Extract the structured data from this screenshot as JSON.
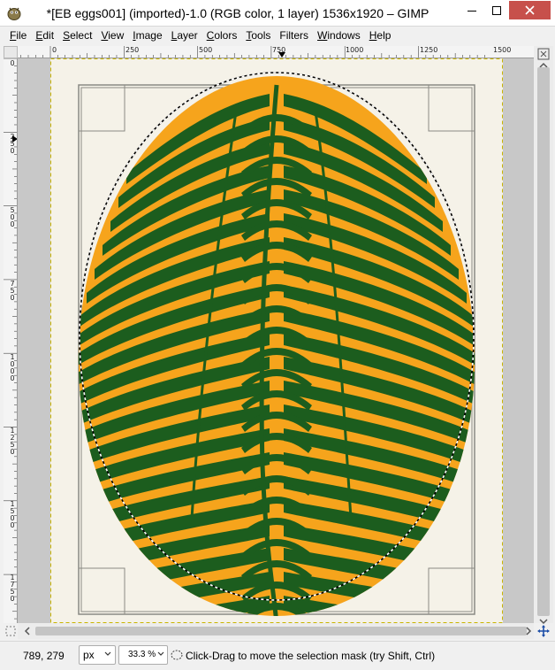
{
  "window": {
    "title": "*[EB eggs001] (imported)-1.0 (RGB color, 1 layer) 1536x1920 – GIMP"
  },
  "menu": [
    {
      "label": "File",
      "acc": "F",
      "rest": "ile"
    },
    {
      "label": "Edit",
      "acc": "E",
      "rest": "dit"
    },
    {
      "label": "Select",
      "acc": "S",
      "rest": "elect"
    },
    {
      "label": "View",
      "acc": "V",
      "rest": "iew"
    },
    {
      "label": "Image",
      "acc": "I",
      "rest": "mage"
    },
    {
      "label": "Layer",
      "acc": "L",
      "rest": "ayer"
    },
    {
      "label": "Colors",
      "acc": "C",
      "rest": "olors"
    },
    {
      "label": "Tools",
      "acc": "T",
      "rest": "ools"
    },
    {
      "label": "Filters",
      "acc": "",
      "rest": "Filters"
    },
    {
      "label": "Windows",
      "acc": "W",
      "rest": "indows"
    },
    {
      "label": "Help",
      "acc": "H",
      "rest": "elp"
    }
  ],
  "ruler": {
    "horizontal_labels": [
      "0",
      "250",
      "500",
      "750",
      "1000",
      "1250",
      "1500"
    ],
    "vertical_labels": [
      "0",
      "250",
      "500",
      "750",
      "1000",
      "1250",
      "1500",
      "1750"
    ]
  },
  "status": {
    "coords": "789, 279",
    "unit": "px",
    "zoom": "33.3 %",
    "message": "Click-Drag to move the selection mask (try Shift, Ctrl)"
  },
  "colors": {
    "egg_orange": "#f6a41c",
    "egg_green": "#1c5d1e",
    "paper": "#f5f2e8",
    "close_button": "#c7504b"
  },
  "icons": {
    "app": "gimp-icon",
    "minimize": "minimize-icon",
    "maximize": "maximize-icon",
    "close": "close-icon",
    "navigate": "navigate-icon",
    "quick_mask": "quick-mask-icon",
    "pan": "pan-cross-icon",
    "selection": "selection-ellipse-icon"
  }
}
